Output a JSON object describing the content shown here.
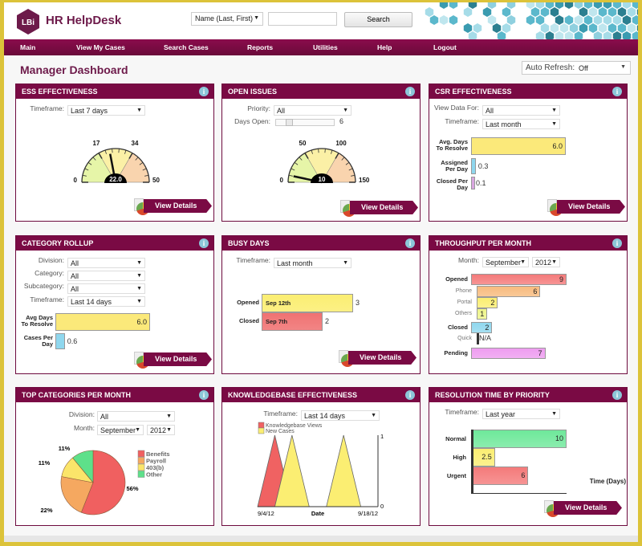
{
  "app": {
    "title": "HR HelpDesk",
    "logo_text": "LBi"
  },
  "header": {
    "search_type": "Name (Last, First)",
    "search_value": "",
    "search_button": "Search"
  },
  "nav": [
    "Main",
    "View My Cases",
    "Search Cases",
    "Reports",
    "Utilities",
    "Help",
    "Logout"
  ],
  "page": {
    "title": "Manager Dashboard",
    "auto_refresh_label": "Auto Refresh:",
    "auto_refresh_value": "Off"
  },
  "view_details": "View Details",
  "panels": {
    "ess": {
      "title": "ESS EFFECTIVENESS",
      "timeframe_label": "Timeframe:",
      "timeframe": "Last 7 days",
      "gauge": {
        "min": "0",
        "t1": "17",
        "t2": "34",
        "max": "50",
        "value": "22.0",
        "value_num": 22,
        "max_num": 50
      }
    },
    "open_issues": {
      "title": "OPEN ISSUES",
      "priority_label": "Priority:",
      "priority": "All",
      "days_open_label": "Days Open:",
      "days_open": "6",
      "days_open_fraction": 0.2,
      "gauge": {
        "min": "0",
        "t1": "50",
        "t2": "100",
        "max": "150",
        "value": "10",
        "value_num": 10,
        "max_num": 150
      }
    },
    "csr": {
      "title": "CSR EFFECTIVENESS",
      "view_for_label": "View Data For:",
      "view_for": "All",
      "timeframe_label": "Timeframe:",
      "timeframe": "Last month",
      "bars": [
        {
          "label": "Avg. Days To Resolve",
          "value": "6.0",
          "num": 6.0,
          "color": "#fbe97a"
        },
        {
          "label": "Assigned Per Day",
          "value": "0.3",
          "num": 0.3,
          "color": "#8fd7ee"
        },
        {
          "label": "Closed Per Day",
          "value": "0.1",
          "num": 0.1,
          "color": "#d9a6e0"
        }
      ]
    },
    "category": {
      "title": "CATEGORY ROLLUP",
      "division_label": "Division:",
      "division": "All",
      "category_label": "Category:",
      "category": "All",
      "subcategory_label": "Subcategory:",
      "subcategory": "All",
      "timeframe_label": "Timeframe:",
      "timeframe": "Last 14 days",
      "bars": [
        {
          "label": "Avg Days To Resolve",
          "value": "6.0",
          "num": 6.0,
          "color": "#fbe97a"
        },
        {
          "label": "Cases Per Day",
          "value": "0.6",
          "num": 0.6,
          "color": "#8fd7ee"
        }
      ]
    },
    "busy": {
      "title": "BUSY DAYS",
      "timeframe_label": "Timeframe:",
      "timeframe": "Last month",
      "bars": [
        {
          "label": "Opened",
          "date": "Sep 12th",
          "value": "3",
          "num": 3,
          "color": "#fbee72"
        },
        {
          "label": "Closed",
          "date": "Sep 7th",
          "value": "2",
          "num": 2,
          "color": "#f07272"
        }
      ]
    },
    "throughput": {
      "title": "THROUGHPUT PER MONTH",
      "month_label": "Month:",
      "month": "September",
      "year": "2012",
      "bars": [
        {
          "label": "Opened",
          "value": "9",
          "num": 9,
          "color": "#f47a7a",
          "main": true
        },
        {
          "label": "Phone",
          "value": "6",
          "num": 6,
          "color": "#f8bb7e",
          "main": false
        },
        {
          "label": "Portal",
          "value": "2",
          "num": 2,
          "color": "#fbee72",
          "main": false
        },
        {
          "label": "Others",
          "value": "1",
          "num": 1,
          "color": "#eef58a",
          "main": false
        },
        {
          "label": "Closed",
          "value": "2",
          "num": 2,
          "color": "#8fd7ee",
          "main": true
        },
        {
          "label": "Quick",
          "value": "N/A",
          "num": 0,
          "color": "#ffffff",
          "main": false
        },
        {
          "label": "Pending",
          "value": "7",
          "num": 7,
          "color": "#ee9cf0",
          "main": true
        }
      ]
    },
    "top_categories": {
      "title": "TOP CATEGORIES PER MONTH",
      "division_label": "Division:",
      "division": "All",
      "month_label": "Month:",
      "month": "September",
      "year": "2012"
    },
    "kb": {
      "title": "KNOWLEDGEBASE EFFECTIVENESS",
      "timeframe_label": "Timeframe:",
      "timeframe": "Last 14 days"
    },
    "resolution": {
      "title": "RESOLUTION TIME BY PRIORITY",
      "timeframe_label": "Timeframe:",
      "timeframe": "Last year",
      "xlabel": "Time (Days)",
      "bars": [
        {
          "label": "Normal",
          "value": "10",
          "num": 10,
          "color": "#6ee89a"
        },
        {
          "label": "High",
          "value": "2.5",
          "num": 2.5,
          "color": "#fbee72"
        },
        {
          "label": "Urgent",
          "value": "6",
          "num": 6,
          "color": "#f47a7a"
        }
      ]
    }
  },
  "chart_data": [
    {
      "type": "pie",
      "title": "Top Categories Per Month",
      "categories": [
        "Benefits",
        "Payroll",
        "403(b)",
        "Other"
      ],
      "values": [
        56,
        22,
        11,
        11
      ],
      "labels": [
        "56%",
        "22%",
        "11%",
        "11%"
      ],
      "colors": [
        "#f06060",
        "#f5a860",
        "#fbe56a",
        "#5ee08a"
      ],
      "legend": "right"
    },
    {
      "type": "area",
      "title": "Knowledgebase Effectiveness",
      "xlabel": "Date",
      "x_ticks": [
        "9/4/12",
        "9/18/12"
      ],
      "y_ticks": [
        "0",
        "1"
      ],
      "ylim": [
        0,
        1
      ],
      "legend": "top-left",
      "series": [
        {
          "name": "Knowledgebase Views",
          "color": "#f06262",
          "x": [
            0,
            1,
            2,
            3,
            4,
            5,
            6,
            7
          ],
          "values": [
            0,
            1,
            0,
            0,
            0,
            0,
            0,
            0
          ]
        },
        {
          "name": "New Cases",
          "color": "#fbee72",
          "x": [
            0,
            1,
            2,
            3,
            4,
            5,
            6,
            7
          ],
          "values": [
            0,
            0,
            1,
            0,
            0,
            1,
            0,
            0
          ]
        }
      ]
    }
  ]
}
